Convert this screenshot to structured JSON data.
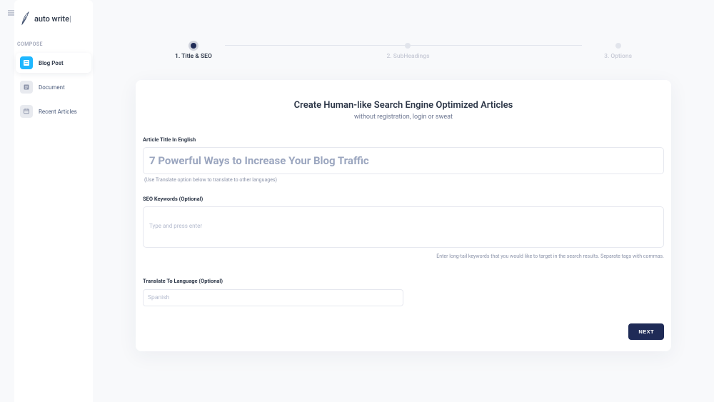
{
  "brand": {
    "name": "auto write",
    "caret": "|"
  },
  "sidebar": {
    "section_label": "COMPOSE",
    "items": [
      {
        "label": "Blog Post"
      },
      {
        "label": "Document"
      },
      {
        "label": "Recent Articles"
      }
    ]
  },
  "stepper": {
    "steps": [
      {
        "label": "1. Title & SEO"
      },
      {
        "label": "2. SubHeadings"
      },
      {
        "label": "3. Options"
      }
    ]
  },
  "card": {
    "title": "Create Human-like Search Engine Optimized Articles",
    "subtitle": "without registration, login or sweat"
  },
  "fields": {
    "title": {
      "label": "Article Title In English",
      "placeholder": "7 Powerful Ways to Increase Your Blog Traffic",
      "hint": "(Use Translate option below to translate to other languages)"
    },
    "keywords": {
      "label": "SEO Keywords (Optional)",
      "placeholder": "Type and press enter",
      "hint": "Enter long-tail keywords that you would like to target in the search results. Separate tags with commas."
    },
    "language": {
      "label": "Translate To Language (Optional)",
      "placeholder": "Spanish"
    }
  },
  "buttons": {
    "next": "NEXT"
  }
}
